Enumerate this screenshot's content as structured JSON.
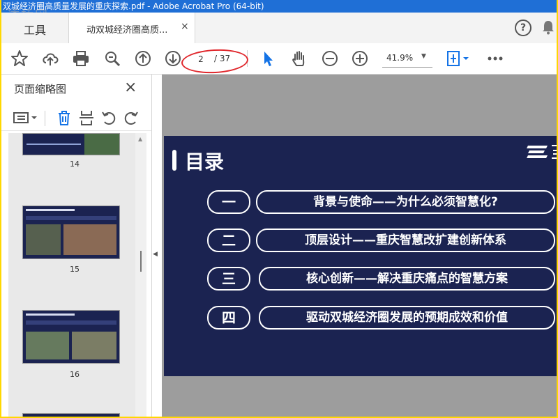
{
  "window": {
    "title": "双城经济圈高质量发展的重庆探索.pdf - Adobe Acrobat Pro (64-bit)"
  },
  "watermark": "透桥网",
  "tabs": {
    "tools_label": "工具",
    "doc_label": "动双城经济圈高质...",
    "close_symbol": "×"
  },
  "toolbar": {
    "current_page": "2",
    "page_total": "/ 37",
    "zoom": "41.9%"
  },
  "left_panel": {
    "title": "页面缩略图",
    "thumbnails": [
      {
        "number": "14"
      },
      {
        "number": "15"
      },
      {
        "number": "16"
      }
    ]
  },
  "slide": {
    "title": "目录",
    "items": [
      {
        "num": "一",
        "text": "背景与使命——为什么必须智慧化?"
      },
      {
        "num": "二",
        "text": "顶层设计——重庆智慧改扩建创新体系"
      },
      {
        "num": "三",
        "text": "核心创新——解决重庆痛点的智慧方案"
      },
      {
        "num": "四",
        "text": "驱动双城经济圈发展的预期成效和价值"
      }
    ]
  },
  "colors": {
    "titlebar": "#1f6fd6",
    "slide_bg": "#1b2351",
    "accent_select": "#1473e6",
    "annotation": "#e0262b"
  },
  "icons": [
    "star-icon",
    "upload-icon",
    "print-icon",
    "zoom-search-icon",
    "prev-page-icon",
    "next-page-icon",
    "select-arrow-icon",
    "hand-icon",
    "zoom-out-icon",
    "zoom-in-icon",
    "fit-page-icon",
    "more-icon",
    "help-icon",
    "bell-icon"
  ]
}
